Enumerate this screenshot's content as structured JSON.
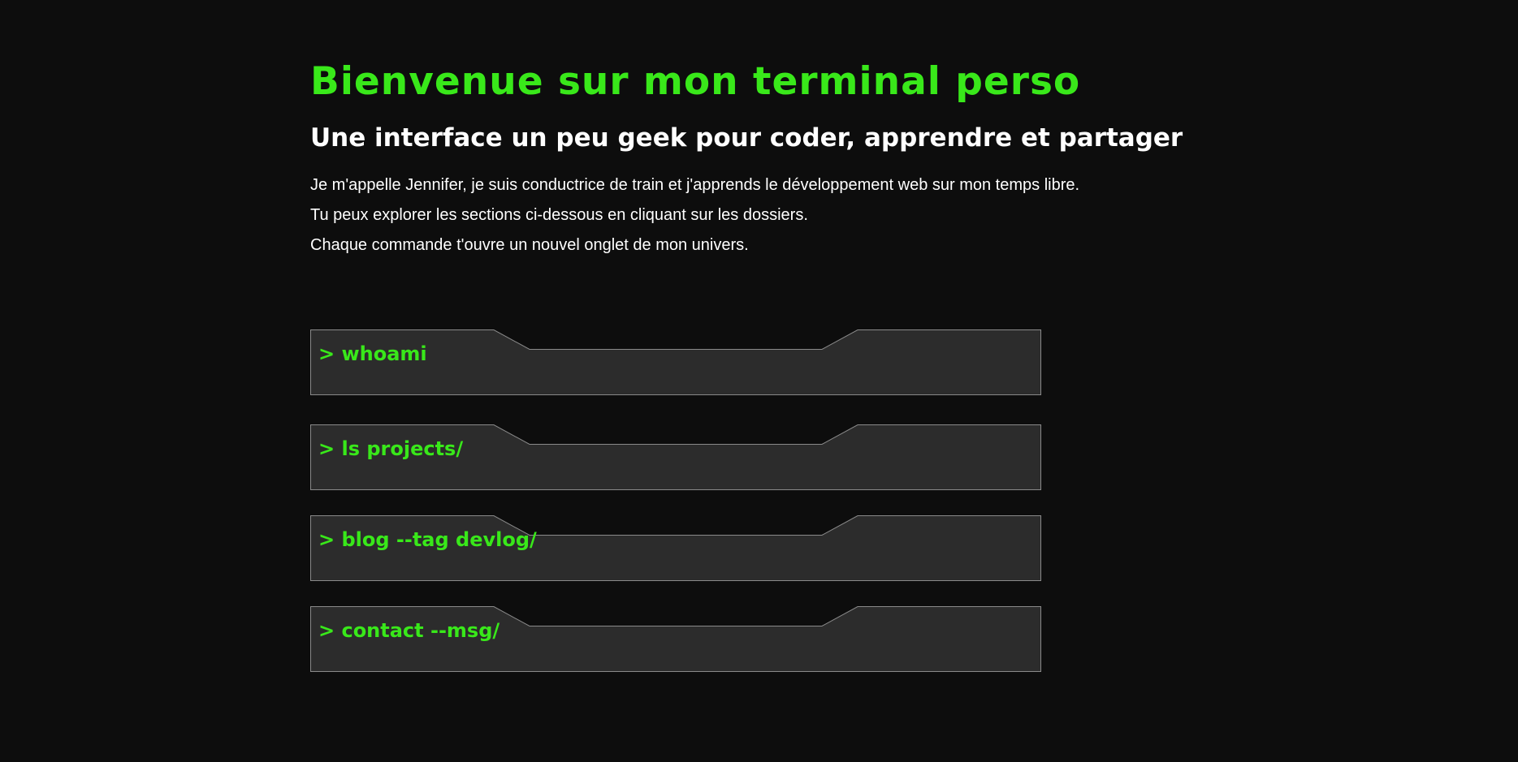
{
  "theme": {
    "background": "#0d0d0d",
    "accent": "#39e81a",
    "folder_fill": "#2c2c2c",
    "folder_border": "#8a8a8a",
    "text": "#ffffff"
  },
  "header": {
    "title": "Bienvenue sur mon terminal perso",
    "subtitle": "Une interface un peu geek pour coder, apprendre et partager"
  },
  "intro": {
    "lines": [
      "Je m'appelle Jennifer, je suis conductrice de train et j'apprends le développement web sur mon temps libre.",
      "Tu peux explorer les sections ci-dessous en cliquant sur les dossiers.",
      "Chaque commande t'ouvre un nouvel onglet de mon univers."
    ]
  },
  "folders": [
    {
      "command": "> whoami"
    },
    {
      "command": "> ls projects/"
    },
    {
      "command": "> blog --tag devlog/"
    },
    {
      "command": "> contact --msg/"
    }
  ]
}
